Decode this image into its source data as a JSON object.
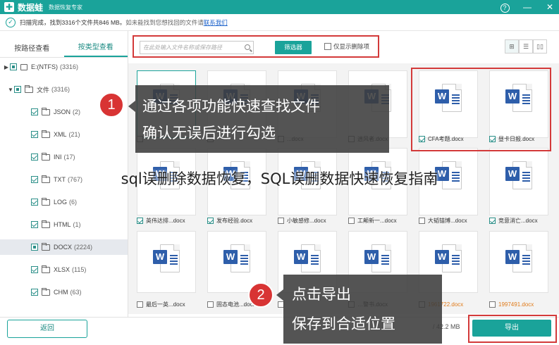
{
  "app": {
    "name": "数据蛙",
    "logo_glyph": "✚",
    "subtitle": "数据恢复专家"
  },
  "window": {
    "help": "?",
    "minimize": "—",
    "close": "✕"
  },
  "status": {
    "text": "扫描完成，找到3316个文件共846 MB。",
    "hint": "如未能找到您想找回的文件请",
    "link": "联系我们"
  },
  "sidebar": {
    "tabs": [
      {
        "label": "按路径查看",
        "active": false
      },
      {
        "label": "按类型查看",
        "active": true
      }
    ],
    "items": [
      {
        "label": "E:(NTFS)",
        "count": "(3316)",
        "level": 0,
        "caret": "▶",
        "check": "part",
        "icon": "drive"
      },
      {
        "label": "文件",
        "count": "(3316)",
        "level": 1,
        "caret": "▼",
        "check": "part",
        "icon": "folder"
      },
      {
        "label": "JSON",
        "count": "(2)",
        "level": 2,
        "caret": "",
        "check": "on",
        "icon": "folder"
      },
      {
        "label": "XML",
        "count": "(21)",
        "level": 2,
        "caret": "",
        "check": "on",
        "icon": "folder"
      },
      {
        "label": "INI",
        "count": "(17)",
        "level": 2,
        "caret": "",
        "check": "on",
        "icon": "folder"
      },
      {
        "label": "TXT",
        "count": "(767)",
        "level": 2,
        "caret": "",
        "check": "on",
        "icon": "folder"
      },
      {
        "label": "LOG",
        "count": "(6)",
        "level": 2,
        "caret": "",
        "check": "on",
        "icon": "folder"
      },
      {
        "label": "HTML",
        "count": "(1)",
        "level": 2,
        "caret": "",
        "check": "on",
        "icon": "folder"
      },
      {
        "label": "DOCX",
        "count": "(2224)",
        "level": 2,
        "caret": "",
        "check": "part",
        "icon": "folder",
        "selected": true
      },
      {
        "label": "XLSX",
        "count": "(115)",
        "level": 2,
        "caret": "",
        "check": "on",
        "icon": "folder"
      },
      {
        "label": "CHM",
        "count": "(63)",
        "level": 2,
        "caret": "",
        "check": "on",
        "icon": "folder"
      }
    ]
  },
  "toolbar": {
    "search_placeholder": "在此处输入文件名称或保存路径",
    "filter_label": "筛选器",
    "only_deleted": "仅显示删除项",
    "views": [
      "⊞",
      "☰",
      "▯▯"
    ]
  },
  "grid": {
    "rows": [
      [
        {
          "name": "",
          "checked": false
        },
        {
          "name": "",
          "checked": false
        },
        {
          "name": "...docx",
          "checked": false
        },
        {
          "name": "逍风者.docx",
          "checked": false
        },
        {
          "name": "CFA考题.docx",
          "checked": true
        },
        {
          "name": "昼卡日报.docx",
          "checked": true
        }
      ],
      [
        {
          "name": "英伟达排...docx",
          "checked": true
        },
        {
          "name": "发布经验.docx",
          "checked": true
        },
        {
          "name": "小敏感修...docx",
          "checked": false
        },
        {
          "name": "工颠新一...docx",
          "checked": false
        },
        {
          "name": "大韬锚博...docx",
          "checked": false
        },
        {
          "name": "竞意消亡...docx",
          "checked": true
        }
      ],
      [
        {
          "name": "最后一英...docx",
          "checked": false
        },
        {
          "name": "固态电池...docx",
          "checked": false
        },
        {
          "name": "",
          "checked": false
        },
        {
          "name": "…警书.docx",
          "checked": false
        },
        {
          "name": "1961722.docx",
          "checked": false,
          "orange": true
        },
        {
          "name": "1997491.docx",
          "checked": false,
          "orange": true
        }
      ]
    ],
    "icon_letter": "W"
  },
  "callouts": {
    "step1": {
      "number": "1",
      "line1": "通过各项功能快速查找文件",
      "line2": "确认无误后进行勾选"
    },
    "step2": {
      "number": "2",
      "line1": "点击导出",
      "line2": "保存到合适位置"
    }
  },
  "watermark": "sql误删除数据恢复，SQL误删数据快速恢复指南",
  "footer": {
    "back_label": "返回",
    "stat": "/ 42.2 MB",
    "export_label": "导出"
  },
  "colors": {
    "accent": "#1aa39a",
    "highlight": "#d33a3a",
    "word": "#2e5eaa"
  }
}
